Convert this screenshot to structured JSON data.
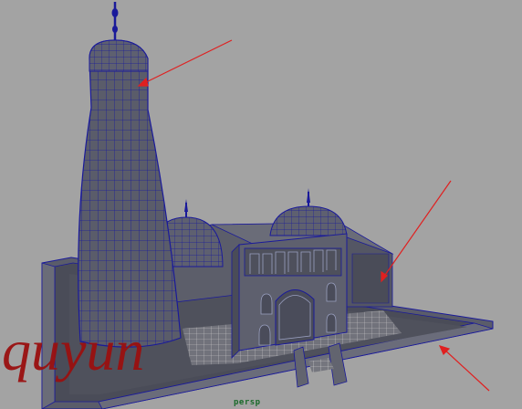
{
  "viewport": {
    "camera_label": "persp",
    "watermark_text": "quyun"
  },
  "colors": {
    "background": "#a3a3a3",
    "model_fill": "#5a5c6a",
    "model_fill_dark": "#45464f",
    "model_fill_light": "#6c6e7c",
    "wireframe": "#1a1a9a",
    "annotation_arrows": "#e02020",
    "camera_label": "#1a6a2a",
    "watermark": "#9a1010"
  },
  "icons": {
    "annotation": "arrow-icon"
  }
}
